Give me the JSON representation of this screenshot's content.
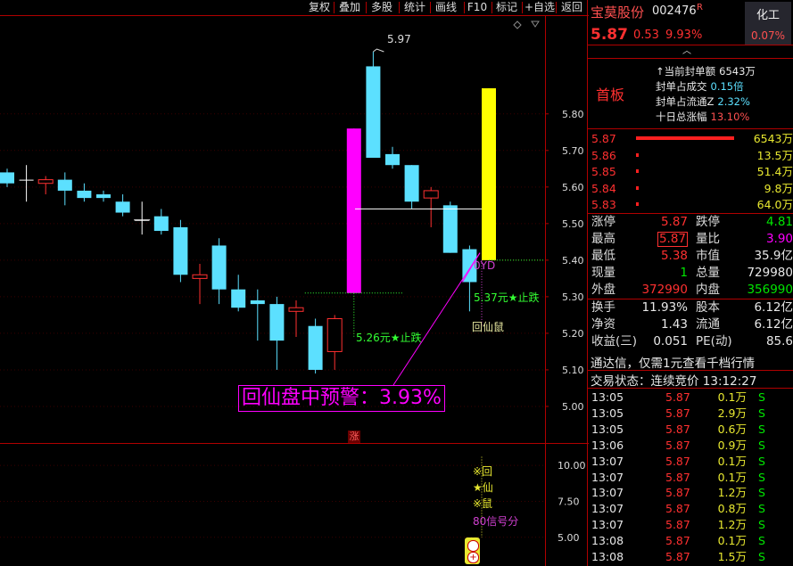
{
  "toolbar": {
    "buttons": [
      "复权",
      "叠加",
      "多股",
      "统计",
      "画线",
      "F10",
      "标记",
      "+自选",
      "返回"
    ]
  },
  "chart_data": [
    {
      "type": "candlestick",
      "ylim": [
        4.9,
        6.07
      ],
      "y_ticks": [
        "5.80",
        "5.70",
        "5.60",
        "5.50",
        "5.40",
        "5.30",
        "5.20",
        "5.10",
        "5.00"
      ],
      "candles": [
        {
          "o": 5.64,
          "h": 5.65,
          "l": 5.6,
          "c": 5.61,
          "color": "cyan"
        },
        {
          "o": 5.62,
          "h": 5.66,
          "l": 5.56,
          "c": 5.62,
          "color": "white"
        },
        {
          "o": 5.61,
          "h": 5.63,
          "l": 5.58,
          "c": 5.62,
          "color": "red"
        },
        {
          "o": 5.62,
          "h": 5.64,
          "l": 5.55,
          "c": 5.59,
          "color": "cyan"
        },
        {
          "o": 5.59,
          "h": 5.61,
          "l": 5.56,
          "c": 5.57,
          "color": "cyan"
        },
        {
          "o": 5.58,
          "h": 5.59,
          "l": 5.56,
          "c": 5.57,
          "color": "cyan"
        },
        {
          "o": 5.56,
          "h": 5.58,
          "l": 5.52,
          "c": 5.53,
          "color": "cyan"
        },
        {
          "o": 5.51,
          "h": 5.56,
          "l": 5.47,
          "c": 5.51,
          "color": "white"
        },
        {
          "o": 5.52,
          "h": 5.54,
          "l": 5.47,
          "c": 5.48,
          "color": "cyan"
        },
        {
          "o": 5.49,
          "h": 5.51,
          "l": 5.34,
          "c": 5.36,
          "color": "cyan"
        },
        {
          "o": 5.35,
          "h": 5.39,
          "l": 5.28,
          "c": 5.36,
          "color": "red"
        },
        {
          "o": 5.44,
          "h": 5.46,
          "l": 5.28,
          "c": 5.32,
          "color": "cyan"
        },
        {
          "o": 5.32,
          "h": 5.36,
          "l": 5.26,
          "c": 5.27,
          "color": "cyan"
        },
        {
          "o": 5.29,
          "h": 5.32,
          "l": 5.18,
          "c": 5.28,
          "color": "cyan"
        },
        {
          "o": 5.28,
          "h": 5.3,
          "l": 5.1,
          "c": 5.18,
          "color": "cyan"
        },
        {
          "o": 5.27,
          "h": 5.29,
          "l": 5.19,
          "c": 5.26,
          "color": "red"
        },
        {
          "o": 5.22,
          "h": 5.24,
          "l": 5.09,
          "c": 5.1,
          "color": "cyan"
        },
        {
          "o": 5.15,
          "h": 5.25,
          "l": 5.1,
          "c": 5.24,
          "color": "red"
        },
        {
          "o": 5.31,
          "h": 5.76,
          "l": 5.31,
          "c": 5.76,
          "color": "magenta"
        },
        {
          "o": 5.93,
          "h": 5.97,
          "l": 5.68,
          "c": 5.68,
          "color": "cyan"
        },
        {
          "o": 5.69,
          "h": 5.71,
          "l": 5.65,
          "c": 5.66,
          "color": "cyan"
        },
        {
          "o": 5.66,
          "h": 5.66,
          "l": 5.54,
          "c": 5.56,
          "color": "cyan"
        },
        {
          "o": 5.57,
          "h": 5.6,
          "l": 5.49,
          "c": 5.59,
          "color": "red"
        },
        {
          "o": 5.55,
          "h": 5.56,
          "l": 5.42,
          "c": 5.42,
          "color": "cyan"
        },
        {
          "o": 5.43,
          "h": 5.44,
          "l": 5.26,
          "c": 5.34,
          "color": "cyan"
        },
        {
          "o": 5.4,
          "h": 5.87,
          "l": 5.4,
          "c": 5.87,
          "color": "yellow"
        }
      ],
      "annotations": {
        "high_label": "5.97",
        "stop_fall_1": "5.26元★止跌",
        "stop_fall_2": "5.37元★止跌",
        "yd_label": "0YD",
        "huixianshu": "回仙鼠",
        "warning": "回仙盘中预警：3.93%",
        "zhang_marker": "涨"
      }
    },
    {
      "type": "bar",
      "ylim": [
        3.0,
        11.5
      ],
      "y_ticks": [
        "10.00",
        "7.50",
        "5.00"
      ],
      "signal_labels": [
        "※回",
        "★仙",
        "※鼠",
        "80信号分"
      ]
    }
  ],
  "stock": {
    "name": "宝莫股份",
    "code": "002476",
    "flag": "R",
    "price": "5.87",
    "change": "0.53",
    "pct": "9.93%",
    "sector_label": "化工",
    "sector_pct": "0.07%",
    "board_label": "首板",
    "info": [
      {
        "label": "当前封单额",
        "value": "6543万"
      },
      {
        "label": "封单占成交",
        "value": "0.15倍"
      },
      {
        "label": "封单占流通Z",
        "value": "2.32%"
      },
      {
        "label": "十日总涨幅",
        "value": "13.10%"
      }
    ]
  },
  "order_book": [
    {
      "price": "5.87",
      "vol": "6543万",
      "bar": 1.0
    },
    {
      "price": "5.86",
      "vol": "13.5万",
      "bar": 0.02
    },
    {
      "price": "5.85",
      "vol": "51.4万",
      "bar": 0.02
    },
    {
      "price": "5.84",
      "vol": "9.8万",
      "bar": 0.02
    },
    {
      "price": "5.83",
      "vol": "64.0万",
      "bar": 0.02
    }
  ],
  "stats": [
    {
      "l1": "涨停",
      "v1": "5.87",
      "c1": "red",
      "l2": "跌停",
      "v2": "4.81",
      "c2": "green"
    },
    {
      "l1": "最高",
      "v1": "5.87",
      "c1": "red",
      "l2": "量比",
      "v2": "3.90",
      "c2": "mag"
    },
    {
      "l1": "最低",
      "v1": "5.38",
      "c1": "red",
      "l2": "市值",
      "v2": "35.9亿",
      "c2": "white"
    },
    {
      "l1": "现量",
      "v1": "1",
      "c1": "green",
      "l2": "总量",
      "v2": "729980",
      "c2": "white"
    },
    {
      "l1": "外盘",
      "v1": "372990",
      "c1": "red",
      "l2": "内盘",
      "v2": "356990",
      "c2": "green"
    },
    {
      "l1": "换手",
      "v1": "11.93%",
      "c1": "white",
      "l2": "股本",
      "v2": "6.12亿",
      "c2": "white"
    },
    {
      "l1": "净资",
      "v1": "1.43",
      "c1": "white",
      "l2": "流通",
      "v2": "6.12亿",
      "c2": "white"
    },
    {
      "l1": "收益(三)",
      "v1": "0.051",
      "c1": "white",
      "l2": "PE(动)",
      "v2": "85.6",
      "c2": "white"
    }
  ],
  "promo_text": "通达信，仅需1元查看千档行情",
  "trade_status": "交易状态：连续竞价 13:12:27",
  "trades": [
    {
      "time": "13:05",
      "price": "5.87",
      "vol": "0.1万",
      "side": "S"
    },
    {
      "time": "13:05",
      "price": "5.87",
      "vol": "2.9万",
      "side": "S"
    },
    {
      "time": "13:05",
      "price": "5.87",
      "vol": "0.6万",
      "side": "S"
    },
    {
      "time": "13:06",
      "price": "5.87",
      "vol": "0.9万",
      "side": "S"
    },
    {
      "time": "13:07",
      "price": "5.87",
      "vol": "0.1万",
      "side": "S"
    },
    {
      "time": "13:07",
      "price": "5.87",
      "vol": "0.1万",
      "side": "S"
    },
    {
      "time": "13:07",
      "price": "5.87",
      "vol": "1.2万",
      "side": "S"
    },
    {
      "time": "13:07",
      "price": "5.87",
      "vol": "0.8万",
      "side": "S"
    },
    {
      "time": "13:07",
      "price": "5.87",
      "vol": "1.2万",
      "side": "S"
    },
    {
      "time": "13:08",
      "price": "5.87",
      "vol": "0.1万",
      "side": "S"
    },
    {
      "time": "13:08",
      "price": "5.87",
      "vol": "1.5万",
      "side": "S"
    }
  ],
  "colors": {
    "up": "#ff3030",
    "down": "#5ce0ff",
    "flat": "#ffffff",
    "board": "#ff00ff",
    "limit": "#ffff00",
    "grid": "#b00000"
  }
}
